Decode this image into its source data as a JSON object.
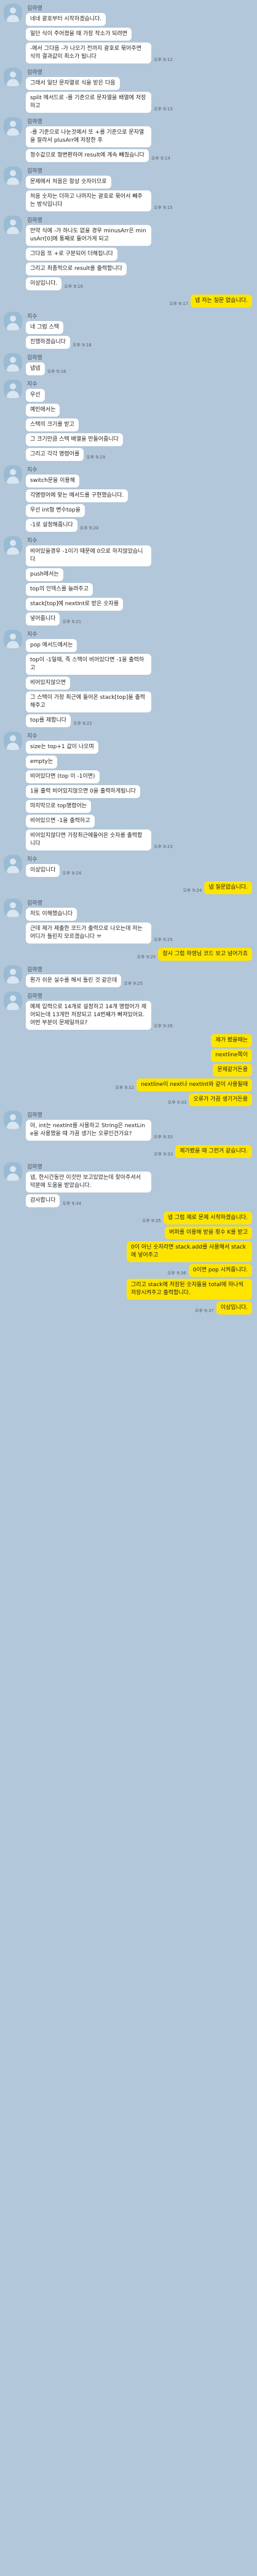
{
  "conversation": [
    {
      "sender": "김하영",
      "side": "left",
      "messages": [
        {
          "text": "네네 괄호부터 시작하겠습니다."
        },
        {
          "text": "일단 식이 주어졌을 때 가장 작소가 되려면"
        },
        {
          "text": "-에서 그다음 -가 나오기 전까지 괄호로 묶어주면 식의 결과값이 최소가 됩니다",
          "time": "오후 9:12"
        }
      ]
    },
    {
      "sender": "김하영",
      "side": "left",
      "messages": [
        {
          "text": "그래서 일단 문자열로 식을 받은 다음"
        },
        {
          "text": "split 메서드로 -를 기준으로 문자열을 배열에 저장하고",
          "time": "오후 9:13"
        }
      ]
    },
    {
      "sender": "김하영",
      "side": "left",
      "messages": [
        {
          "text": "-를 기준으로 나눈것에서 또 +를 기준으로 문자열을 잘라서 plusArr에 저장한 후"
        },
        {
          "text": "정수값으로 형변환하여 result에 계속 빼줬습니다",
          "time": "오후 9:14"
        }
      ]
    },
    {
      "sender": "김하영",
      "side": "left",
      "messages": [
        {
          "text": "문제에서 처음은 항상 숫자이므로"
        },
        {
          "text": "처음 숫자는 더하고 나머지는 괄호로 묶어서 빼주는 방식입니다",
          "time": "오후 9:15"
        }
      ]
    },
    {
      "sender": "김하영",
      "side": "left",
      "messages": [
        {
          "text": "만약 식에 -가 하나도 없을 경우 minusArr은 minusArr[0]에 통째로 들어가게 되고"
        },
        {
          "text": "그다음 또 +로 구분되어 더해집니다"
        },
        {
          "text": "그리고 최종적으로 result를 출력합니다"
        },
        {
          "text": "이상입니다.",
          "time": "오후 9:16"
        }
      ]
    },
    {
      "side": "right",
      "messages": [
        {
          "text": "넵 저는 질문 없습니다.",
          "time": "오후 9:17"
        }
      ]
    },
    {
      "sender": "지수",
      "side": "left",
      "messages": [
        {
          "text": "네 그럼 스택"
        },
        {
          "text": "진행하겠습니다",
          "time": "오후 9:18"
        }
      ]
    },
    {
      "sender": "김하영",
      "side": "left",
      "messages": [
        {
          "text": "넵넵",
          "time": "오후 9:18"
        }
      ]
    },
    {
      "sender": "지수",
      "side": "left",
      "messages": [
        {
          "text": "우선"
        },
        {
          "text": "예민에서는"
        },
        {
          "text": "스택의 크기를 받고"
        },
        {
          "text": "그 크기만큼 스택 배열을 만들어줍니다"
        },
        {
          "text": "그리고 각각 명령어를",
          "time": "오후 9:19"
        }
      ]
    },
    {
      "sender": "지수",
      "side": "left",
      "messages": [
        {
          "text": "switch문을 이용해"
        },
        {
          "text": "각명령어에 맞는 메서드를 구현했습니다."
        },
        {
          "text": "우선 int형 변수top을"
        },
        {
          "text": "-1로 설정해줍니다",
          "time": "오후 9:20"
        }
      ]
    },
    {
      "sender": "지수",
      "side": "left",
      "messages": [
        {
          "text": "비어있을경우 -1이기 때문에 0으로 하지않았습니다"
        },
        {
          "text": "push에서는"
        },
        {
          "text": "top의 인덱스를 늘려주고"
        },
        {
          "text": "stack[top]에 nextInt로 받은 숫자를"
        },
        {
          "text": "넣어줍니다",
          "time": "오후 9:21"
        }
      ]
    },
    {
      "sender": "지수",
      "side": "left",
      "messages": [
        {
          "text": "pop 메서드에서는"
        },
        {
          "text": "top이 -1일때, 즉 스택이 비어있다면 -1을 출력하고"
        },
        {
          "text": "비어있지않으면"
        },
        {
          "text": "그 스택이 가장 최근에 들어온 stack[top]을 출력해주고"
        },
        {
          "text": "top를 제합니다",
          "time": "오후 9:22"
        }
      ]
    },
    {
      "sender": "지수",
      "side": "left",
      "messages": [
        {
          "text": "size는 top+1 값이 나오며"
        },
        {
          "text": "empty는"
        },
        {
          "text": "비어있다면 (top 이 -1이면)"
        },
        {
          "text": "1을 출력 비어있지않으면 0을 출력하게됩니다"
        },
        {
          "text": "마지막으로 top명령어는"
        },
        {
          "text": "비어있으면 -1을 출력하고"
        },
        {
          "text": "비어있지않다면 가장최근에들어온 숫자를 출력합니다",
          "time": "오후 9:23"
        }
      ]
    },
    {
      "sender": "지수",
      "side": "left",
      "messages": [
        {
          "text": "이상입니다",
          "time": "오후 9:24"
        }
      ]
    },
    {
      "side": "right",
      "messages": [
        {
          "text": "넵 질문없습니다.",
          "time": "오후 9:24"
        }
      ]
    },
    {
      "sender": "김하영",
      "side": "left",
      "messages": [
        {
          "text": "저도 이해했습니다"
        },
        {
          "text": "근데 제가 제출한 코드가 출력으로 나오는데 저는 어디가 틀린지 모르겠습니다 ㅠ",
          "time": "오후 9:25"
        }
      ]
    },
    {
      "side": "right",
      "messages": [
        {
          "text": "잠시 그럼 하영님 코드 보고 넘어가죠",
          "time": "오후 9:25"
        }
      ]
    },
    {
      "sender": "김하영",
      "side": "left",
      "messages": [
        {
          "text": "뭔가 쉬운 실수를 해서 틀린 것 같은데",
          "time": "오후 9:25"
        }
      ]
    },
    {
      "sender": "김하영",
      "side": "left",
      "messages": [
        {
          "text": "예제 입력으로 14개로 설정하고 14개 명령어가 제어되는데 13개만 저장되고 14번째가 빠져있어요. 어떤 부분이 문제일까요?",
          "time": "오후 9:26"
        }
      ]
    },
    {
      "side": "right",
      "messages": [
        {
          "text": "제가 봤을때는"
        },
        {
          "text": "nextline쪽이"
        },
        {
          "text": "문제같거든용"
        },
        {
          "text": "nextline이 next나 nextInt와 같이 사용될때",
          "time": "오후 9:32"
        },
        {
          "text": "오류가 가끔 생기거든용",
          "time": "오후 9:33"
        }
      ]
    },
    {
      "sender": "김하영",
      "side": "left",
      "messages": [
        {
          "text": "아, int는 nextInt를 사용하고 String은 nextLine을 사용했을 때 가끔 생기는 오류인건가요?",
          "time": "오후 9:33"
        }
      ]
    },
    {
      "side": "right",
      "messages": [
        {
          "text": "제가봤을 때 그런거 같습니다.",
          "time": "오후 9:33"
        }
      ]
    },
    {
      "sender": "김하영",
      "side": "left",
      "messages": [
        {
          "text": "넵, 한시간동안 이것만 보고있었는데 찾아주셔서 덕분에 도움을 받았습니다."
        },
        {
          "text": "감사합니다",
          "time": "오후 9:34"
        }
      ]
    },
    {
      "side": "right",
      "messages": [
        {
          "text": "넵 그럼 제로 문제 시작하겠습니다.",
          "time": "오후 9:35"
        },
        {
          "text": "버퍼를 이용해 받을 횟수 K를 받고"
        },
        {
          "text": "0이 아닌 숫자라면 stack.add를 사용해서 stack에 넣어주고"
        },
        {
          "text": "0이면 pop 시켜줍니다.",
          "time": "오후 9:36"
        },
        {
          "text": "그리고 stack에 저장된 숫자들을 total에 하나씩 저장시켜주고 출력합니다."
        },
        {
          "text": "이상입니다.",
          "time": "오후 9:37"
        }
      ]
    }
  ]
}
